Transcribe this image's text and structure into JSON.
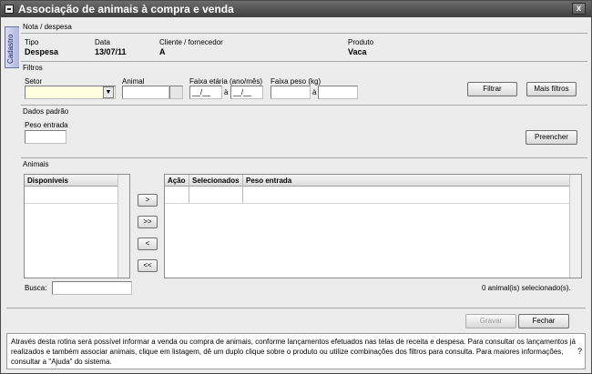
{
  "window": {
    "title": "Associação de animais à compra e venda",
    "close_label": "x"
  },
  "sidetab": {
    "label": "Cadastro"
  },
  "nota": {
    "section_title": "Nota / despesa",
    "tipo_label": "Tipo",
    "tipo_value": "Despesa",
    "data_label": "Data",
    "data_value": "13/07/11",
    "cliente_label": "Cliente / fornecedor",
    "cliente_value": "A",
    "produto_label": "Produto",
    "produto_value": "Vaca"
  },
  "filtros": {
    "section_title": "Filtros",
    "setor_label": "Setor",
    "animal_label": "Animal",
    "faixa_etaria_label": "Faixa etária (ano/mês)",
    "faixa_etaria_from": "__/__",
    "faixa_etaria_to": "__/__",
    "faixa_peso_label": "Faixa peso (kg)",
    "range_sep": "à",
    "filtrar_button": "Filtrar",
    "mais_filtros_button": "Mais filtros"
  },
  "dados_padrao": {
    "section_title": "Dados padrão",
    "peso_entrada_label": "Peso entrada",
    "preencher_button": "Preencher"
  },
  "animais": {
    "section_title": "Animais",
    "disponiveis_header": "Disponíveis",
    "selected_headers": [
      "Ação",
      "Selecionados",
      "Peso entrada"
    ],
    "move_buttons": [
      ">",
      ">>",
      "<",
      "<<"
    ],
    "busca_label": "Busca:",
    "status_text": "0 animal(is) selecionado(s)."
  },
  "footer": {
    "gravar_button": "Gravar",
    "fechar_button": "Fechar"
  },
  "help": {
    "text": "Através desta rotina será possível informar a venda ou compra de animais, conforme lançamentos efetuados nas telas de receita e despesa. Para consultar os lançamentos já realizados e também associar animais, clique em listagem, dê um duplo clique sobre o produto ou utilize combinações dos filtros para consulta. Para maiores informações, consultar a \"Ajuda\" do sistema.",
    "question_mark": "?"
  }
}
